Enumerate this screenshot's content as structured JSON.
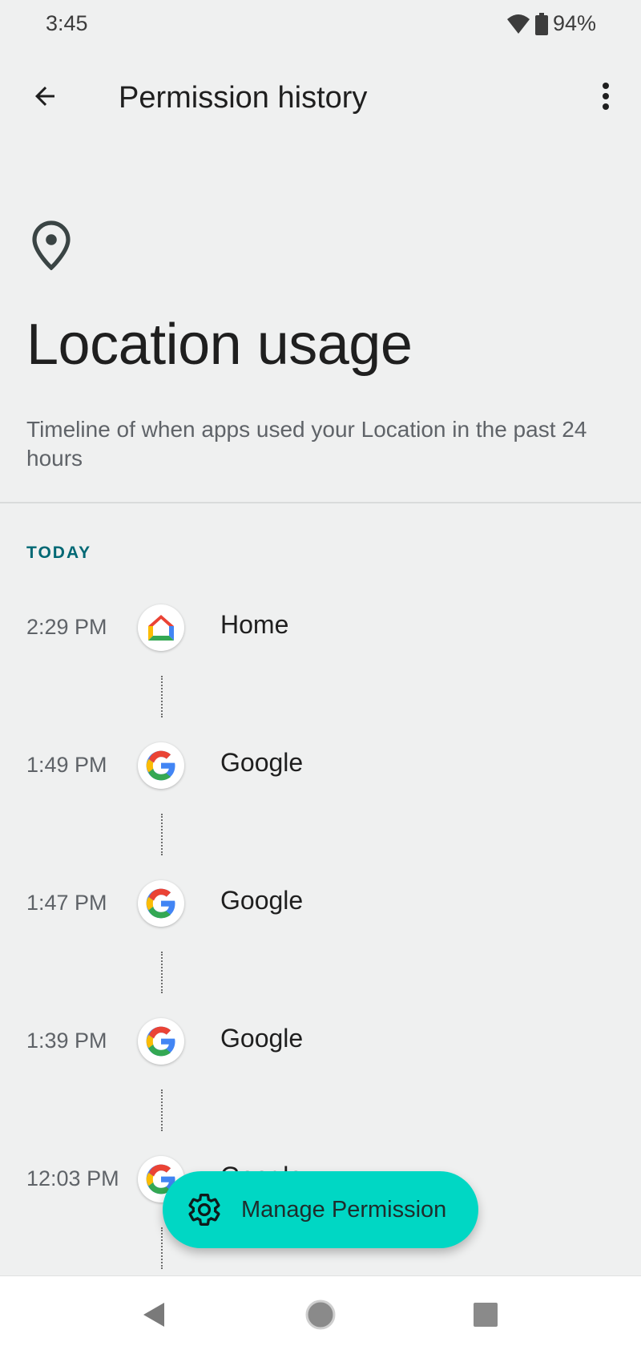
{
  "status_bar": {
    "time": "3:45",
    "battery": "94%",
    "icons": [
      "wifi-icon",
      "battery-icon"
    ]
  },
  "app_bar": {
    "title": "Permission history",
    "back_icon": "arrow-back-icon",
    "more_icon": "more-vert-icon"
  },
  "header": {
    "icon": "location-pin-icon",
    "title": "Location usage",
    "subtitle": "Timeline of when apps used your Location in the past 24 hours"
  },
  "timeline": {
    "section_label": "TODAY",
    "entries": [
      {
        "time": "2:29 PM",
        "app": "Home",
        "icon": "google-home-icon"
      },
      {
        "time": "1:49 PM",
        "app": "Google",
        "icon": "google-icon"
      },
      {
        "time": "1:47 PM",
        "app": "Google",
        "icon": "google-icon"
      },
      {
        "time": "1:39 PM",
        "app": "Google",
        "icon": "google-icon"
      },
      {
        "time": "12:03 PM",
        "app": "Google",
        "icon": "google-icon"
      }
    ]
  },
  "fab": {
    "label": "Manage Permission",
    "icon": "gear-icon",
    "color": "#00d7c4"
  },
  "nav_bar": {
    "buttons": [
      "back-triangle-icon",
      "home-circle-icon",
      "recents-square-icon"
    ]
  },
  "colors": {
    "background": "#eff0f0",
    "section_accent": "#006874",
    "secondary_text": "#5f6368"
  }
}
